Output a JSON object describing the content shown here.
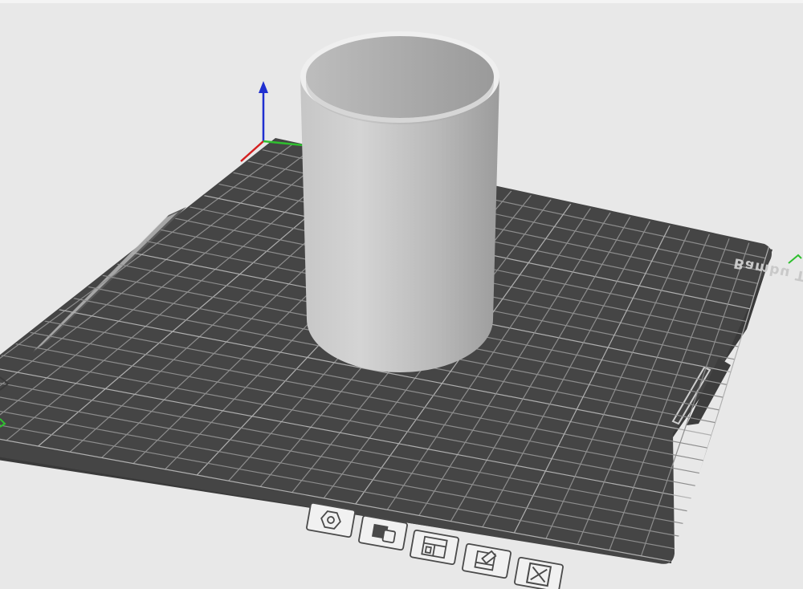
{
  "viewport": {
    "plate_name": "Bambu Textured PEI Plate",
    "slot_label": "",
    "colors": {
      "background": "#e8e8e8",
      "plate": "#454545",
      "grid": "#8a8a8a",
      "object": "#c4c4c4",
      "axis_x": "#d42020",
      "axis_y": "#2fbf2f",
      "axis_z": "#1f2fd0"
    }
  },
  "plate_toolbar": {
    "items": [
      {
        "icon": "orient-icon",
        "label": ""
      },
      {
        "icon": "arrange-icon",
        "label": ""
      },
      {
        "icon": "layout-icon",
        "label": ""
      },
      {
        "icon": "plate-settings-icon",
        "label": ""
      },
      {
        "icon": "close-icon",
        "label": ""
      }
    ]
  }
}
